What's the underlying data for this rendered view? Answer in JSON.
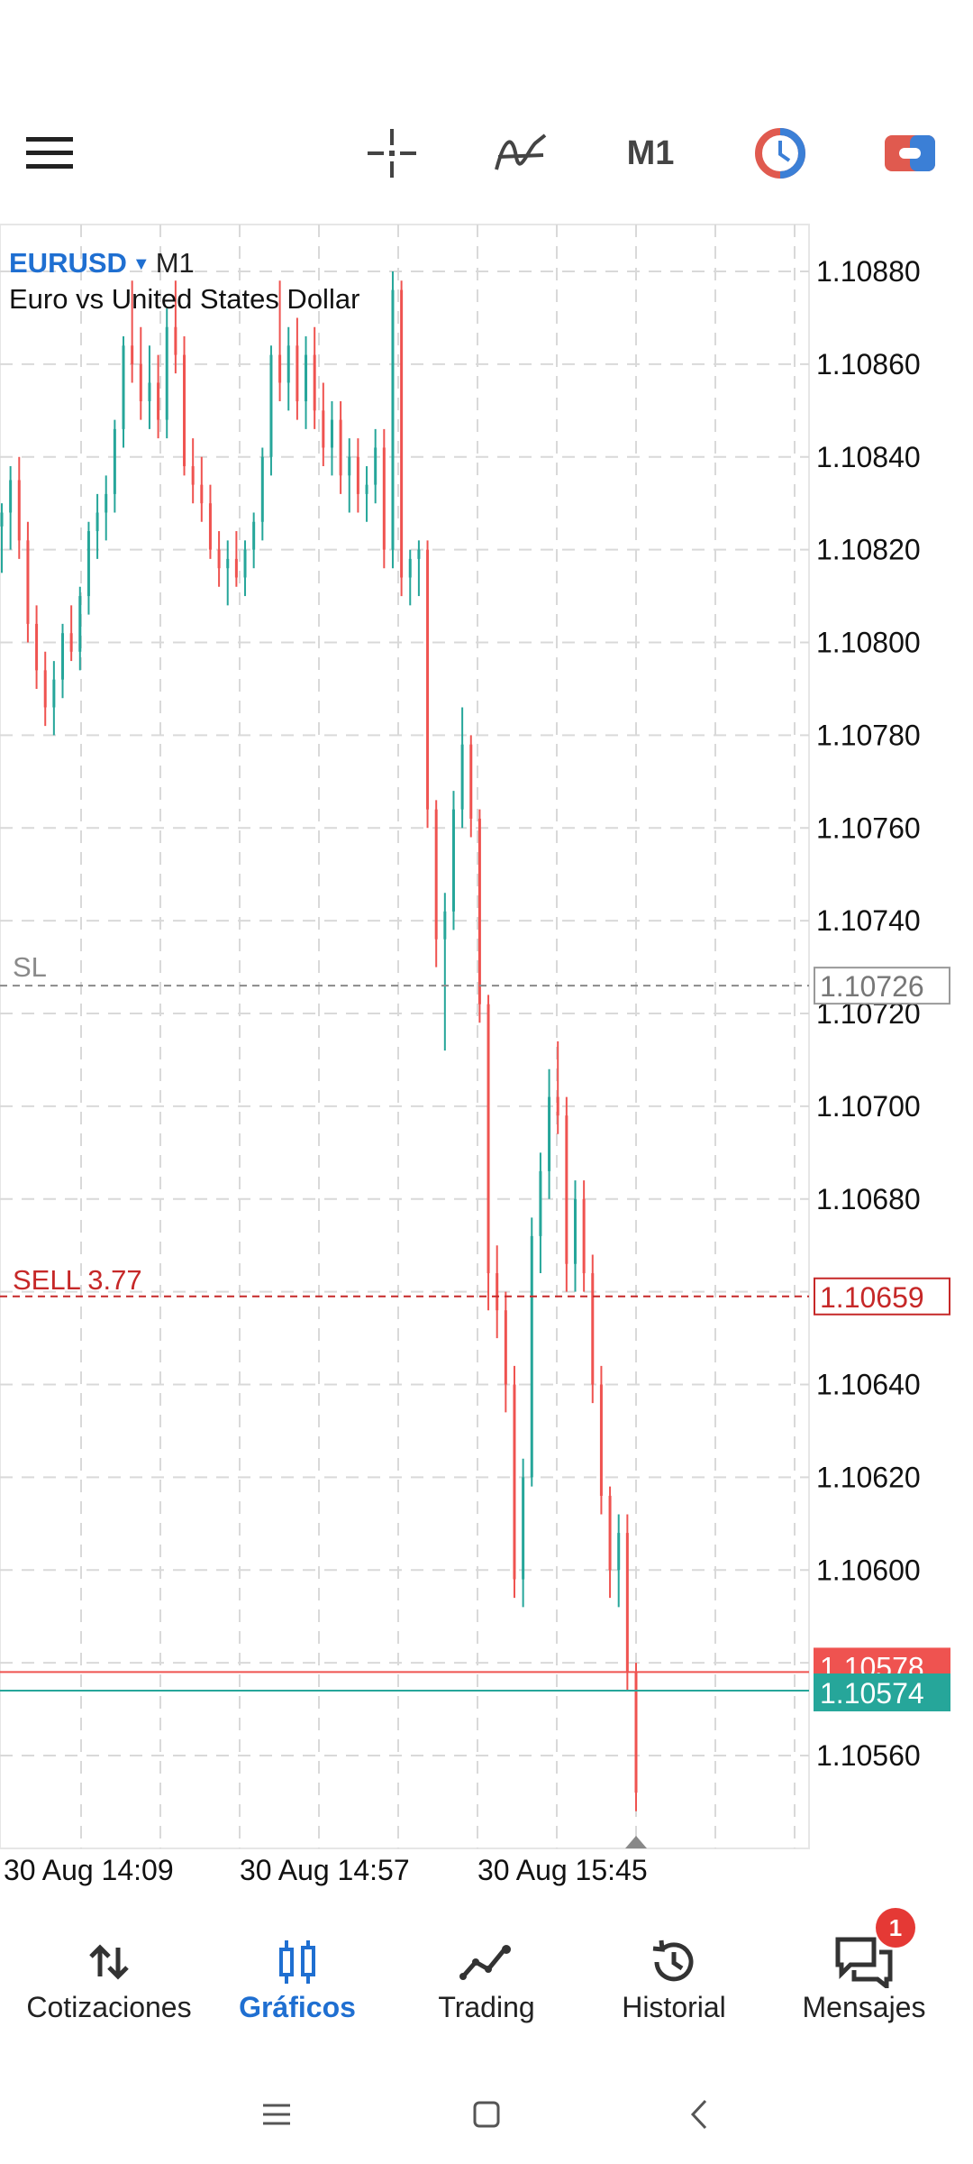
{
  "toolbar": {
    "menu_icon": "hamburger-menu-icon",
    "crosshair_icon": "crosshair-icon",
    "indicators_icon": "indicators-icon",
    "timeframe": "M1",
    "one_click_icon": "one-click-trading-icon",
    "trade_icon": "trade-panel-icon"
  },
  "symbol": {
    "name": "EURUSD",
    "timeframe": "M1",
    "description": "Euro vs United States Dollar"
  },
  "colors": {
    "bull": "#26a69a",
    "bear": "#ef5350",
    "accent": "#1f6fd1",
    "sell_line": "#c62828",
    "sl_line": "#8a8a8a",
    "grid": "#d9d9d9"
  },
  "price_lines": {
    "sl": {
      "label": "SL",
      "price": "1.10726",
      "value": 1.10726
    },
    "sell": {
      "label": "SELL 3.77",
      "price": "1.10659",
      "value": 1.10659
    },
    "ask": {
      "price": "1.10578",
      "value": 1.10578
    },
    "bid": {
      "price": "1.10574",
      "value": 1.10574
    }
  },
  "chart_data": {
    "type": "candlestick",
    "symbol": "EURUSD",
    "timeframe": "M1",
    "ylim": [
      1.10545,
      1.10885
    ],
    "y_ticks": [
      "1.10880",
      "1.10860",
      "1.10840",
      "1.10820",
      "1.10800",
      "1.10780",
      "1.10760",
      "1.10740",
      "1.10720",
      "1.10700",
      "1.10680",
      "1.10660",
      "1.10640",
      "1.10620",
      "1.10600",
      "1.10580",
      "1.10560"
    ],
    "x_ticks": [
      "30 Aug 14:09",
      "30 Aug 14:57",
      "30 Aug 15:45"
    ],
    "candles": [
      {
        "o": 1.10825,
        "h": 1.1083,
        "l": 1.10815,
        "c": 1.10828
      },
      {
        "o": 1.10828,
        "h": 1.10838,
        "l": 1.1082,
        "c": 1.10835
      },
      {
        "o": 1.10835,
        "h": 1.1084,
        "l": 1.10818,
        "c": 1.10822
      },
      {
        "o": 1.10822,
        "h": 1.10826,
        "l": 1.108,
        "c": 1.10804
      },
      {
        "o": 1.10804,
        "h": 1.10808,
        "l": 1.1079,
        "c": 1.10794
      },
      {
        "o": 1.10794,
        "h": 1.10798,
        "l": 1.10782,
        "c": 1.10786
      },
      {
        "o": 1.10786,
        "h": 1.10796,
        "l": 1.1078,
        "c": 1.10792
      },
      {
        "o": 1.10792,
        "h": 1.10804,
        "l": 1.10788,
        "c": 1.10802
      },
      {
        "o": 1.10802,
        "h": 1.10808,
        "l": 1.10796,
        "c": 1.10798
      },
      {
        "o": 1.10798,
        "h": 1.10812,
        "l": 1.10794,
        "c": 1.1081
      },
      {
        "o": 1.1081,
        "h": 1.10826,
        "l": 1.10806,
        "c": 1.10824
      },
      {
        "o": 1.10824,
        "h": 1.10832,
        "l": 1.10818,
        "c": 1.10828
      },
      {
        "o": 1.10828,
        "h": 1.10836,
        "l": 1.10822,
        "c": 1.10832
      },
      {
        "o": 1.10832,
        "h": 1.10848,
        "l": 1.10828,
        "c": 1.10846
      },
      {
        "o": 1.10846,
        "h": 1.10866,
        "l": 1.10842,
        "c": 1.10864
      },
      {
        "o": 1.10864,
        "h": 1.10878,
        "l": 1.10856,
        "c": 1.1086
      },
      {
        "o": 1.1086,
        "h": 1.10868,
        "l": 1.10848,
        "c": 1.10852
      },
      {
        "o": 1.10852,
        "h": 1.10864,
        "l": 1.10846,
        "c": 1.10856
      },
      {
        "o": 1.10856,
        "h": 1.10862,
        "l": 1.10844,
        "c": 1.10848
      },
      {
        "o": 1.10848,
        "h": 1.10872,
        "l": 1.10844,
        "c": 1.10868
      },
      {
        "o": 1.10868,
        "h": 1.10878,
        "l": 1.10858,
        "c": 1.10862
      },
      {
        "o": 1.10862,
        "h": 1.10866,
        "l": 1.10836,
        "c": 1.10838
      },
      {
        "o": 1.10838,
        "h": 1.10844,
        "l": 1.1083,
        "c": 1.10834
      },
      {
        "o": 1.10834,
        "h": 1.1084,
        "l": 1.10826,
        "c": 1.1083
      },
      {
        "o": 1.1083,
        "h": 1.10834,
        "l": 1.10818,
        "c": 1.1082
      },
      {
        "o": 1.1082,
        "h": 1.10824,
        "l": 1.10812,
        "c": 1.10816
      },
      {
        "o": 1.10816,
        "h": 1.10822,
        "l": 1.10808,
        "c": 1.10818
      },
      {
        "o": 1.10818,
        "h": 1.10824,
        "l": 1.10812,
        "c": 1.10814
      },
      {
        "o": 1.10814,
        "h": 1.10822,
        "l": 1.1081,
        "c": 1.1082
      },
      {
        "o": 1.1082,
        "h": 1.10828,
        "l": 1.10816,
        "c": 1.10826
      },
      {
        "o": 1.10826,
        "h": 1.10842,
        "l": 1.10822,
        "c": 1.1084
      },
      {
        "o": 1.1084,
        "h": 1.10864,
        "l": 1.10836,
        "c": 1.10862
      },
      {
        "o": 1.10862,
        "h": 1.10878,
        "l": 1.10852,
        "c": 1.10856
      },
      {
        "o": 1.10856,
        "h": 1.10868,
        "l": 1.1085,
        "c": 1.10864
      },
      {
        "o": 1.10864,
        "h": 1.1087,
        "l": 1.10848,
        "c": 1.10852
      },
      {
        "o": 1.10852,
        "h": 1.10866,
        "l": 1.10846,
        "c": 1.10862
      },
      {
        "o": 1.10862,
        "h": 1.10868,
        "l": 1.10846,
        "c": 1.1085
      },
      {
        "o": 1.1085,
        "h": 1.10856,
        "l": 1.10838,
        "c": 1.10842
      },
      {
        "o": 1.10842,
        "h": 1.10852,
        "l": 1.10836,
        "c": 1.10848
      },
      {
        "o": 1.10848,
        "h": 1.10852,
        "l": 1.10832,
        "c": 1.10836
      },
      {
        "o": 1.10836,
        "h": 1.10844,
        "l": 1.10828,
        "c": 1.1084
      },
      {
        "o": 1.1084,
        "h": 1.10844,
        "l": 1.10828,
        "c": 1.10832
      },
      {
        "o": 1.10832,
        "h": 1.10838,
        "l": 1.10826,
        "c": 1.10834
      },
      {
        "o": 1.10834,
        "h": 1.10846,
        "l": 1.1083,
        "c": 1.10842
      },
      {
        "o": 1.10842,
        "h": 1.10846,
        "l": 1.10816,
        "c": 1.1082
      },
      {
        "o": 1.1082,
        "h": 1.1088,
        "l": 1.10816,
        "c": 1.10876
      },
      {
        "o": 1.10876,
        "h": 1.10878,
        "l": 1.1081,
        "c": 1.10814
      },
      {
        "o": 1.10814,
        "h": 1.1082,
        "l": 1.10808,
        "c": 1.10818
      },
      {
        "o": 1.10818,
        "h": 1.10822,
        "l": 1.1081,
        "c": 1.1082
      },
      {
        "o": 1.1082,
        "h": 1.10822,
        "l": 1.1076,
        "c": 1.10764
      },
      {
        "o": 1.10764,
        "h": 1.10766,
        "l": 1.1073,
        "c": 1.10736
      },
      {
        "o": 1.10736,
        "h": 1.10746,
        "l": 1.10712,
        "c": 1.10742
      },
      {
        "o": 1.10742,
        "h": 1.10768,
        "l": 1.10738,
        "c": 1.10764
      },
      {
        "o": 1.10764,
        "h": 1.10786,
        "l": 1.1076,
        "c": 1.10778
      },
      {
        "o": 1.10778,
        "h": 1.1078,
        "l": 1.10758,
        "c": 1.10762
      },
      {
        "o": 1.10762,
        "h": 1.10764,
        "l": 1.10718,
        "c": 1.10722
      },
      {
        "o": 1.10722,
        "h": 1.10724,
        "l": 1.10656,
        "c": 1.10664
      },
      {
        "o": 1.10664,
        "h": 1.1067,
        "l": 1.1065,
        "c": 1.10656
      },
      {
        "o": 1.10656,
        "h": 1.1066,
        "l": 1.10634,
        "c": 1.1064
      },
      {
        "o": 1.1064,
        "h": 1.10644,
        "l": 1.10594,
        "c": 1.10598
      },
      {
        "o": 1.10598,
        "h": 1.10624,
        "l": 1.10592,
        "c": 1.1062
      },
      {
        "o": 1.1062,
        "h": 1.10676,
        "l": 1.10618,
        "c": 1.10672
      },
      {
        "o": 1.10672,
        "h": 1.1069,
        "l": 1.10664,
        "c": 1.10686
      },
      {
        "o": 1.10686,
        "h": 1.10708,
        "l": 1.1068,
        "c": 1.10702
      },
      {
        "o": 1.10702,
        "h": 1.10714,
        "l": 1.10694,
        "c": 1.10698
      },
      {
        "o": 1.10698,
        "h": 1.10702,
        "l": 1.1066,
        "c": 1.10666
      },
      {
        "o": 1.10666,
        "h": 1.10684,
        "l": 1.1066,
        "c": 1.1068
      },
      {
        "o": 1.1068,
        "h": 1.10684,
        "l": 1.1066,
        "c": 1.10664
      },
      {
        "o": 1.10664,
        "h": 1.10668,
        "l": 1.10636,
        "c": 1.1064
      },
      {
        "o": 1.1064,
        "h": 1.10644,
        "l": 1.10612,
        "c": 1.10616
      },
      {
        "o": 1.10616,
        "h": 1.10618,
        "l": 1.10594,
        "c": 1.106
      },
      {
        "o": 1.106,
        "h": 1.10612,
        "l": 1.10592,
        "c": 1.10608
      },
      {
        "o": 1.10608,
        "h": 1.10612,
        "l": 1.10574,
        "c": 1.10578
      },
      {
        "o": 1.10578,
        "h": 1.1058,
        "l": 1.10548,
        "c": 1.10552
      }
    ]
  },
  "nav": {
    "items": [
      {
        "label": "Cotizaciones",
        "icon": "quotes-arrows-icon"
      },
      {
        "label": "Gráficos",
        "icon": "charts-candles-icon"
      },
      {
        "label": "Trading",
        "icon": "trading-line-icon"
      },
      {
        "label": "Historial",
        "icon": "history-clock-icon"
      },
      {
        "label": "Mensajes",
        "icon": "messages-chat-icon"
      }
    ],
    "messages_badge": "1"
  }
}
